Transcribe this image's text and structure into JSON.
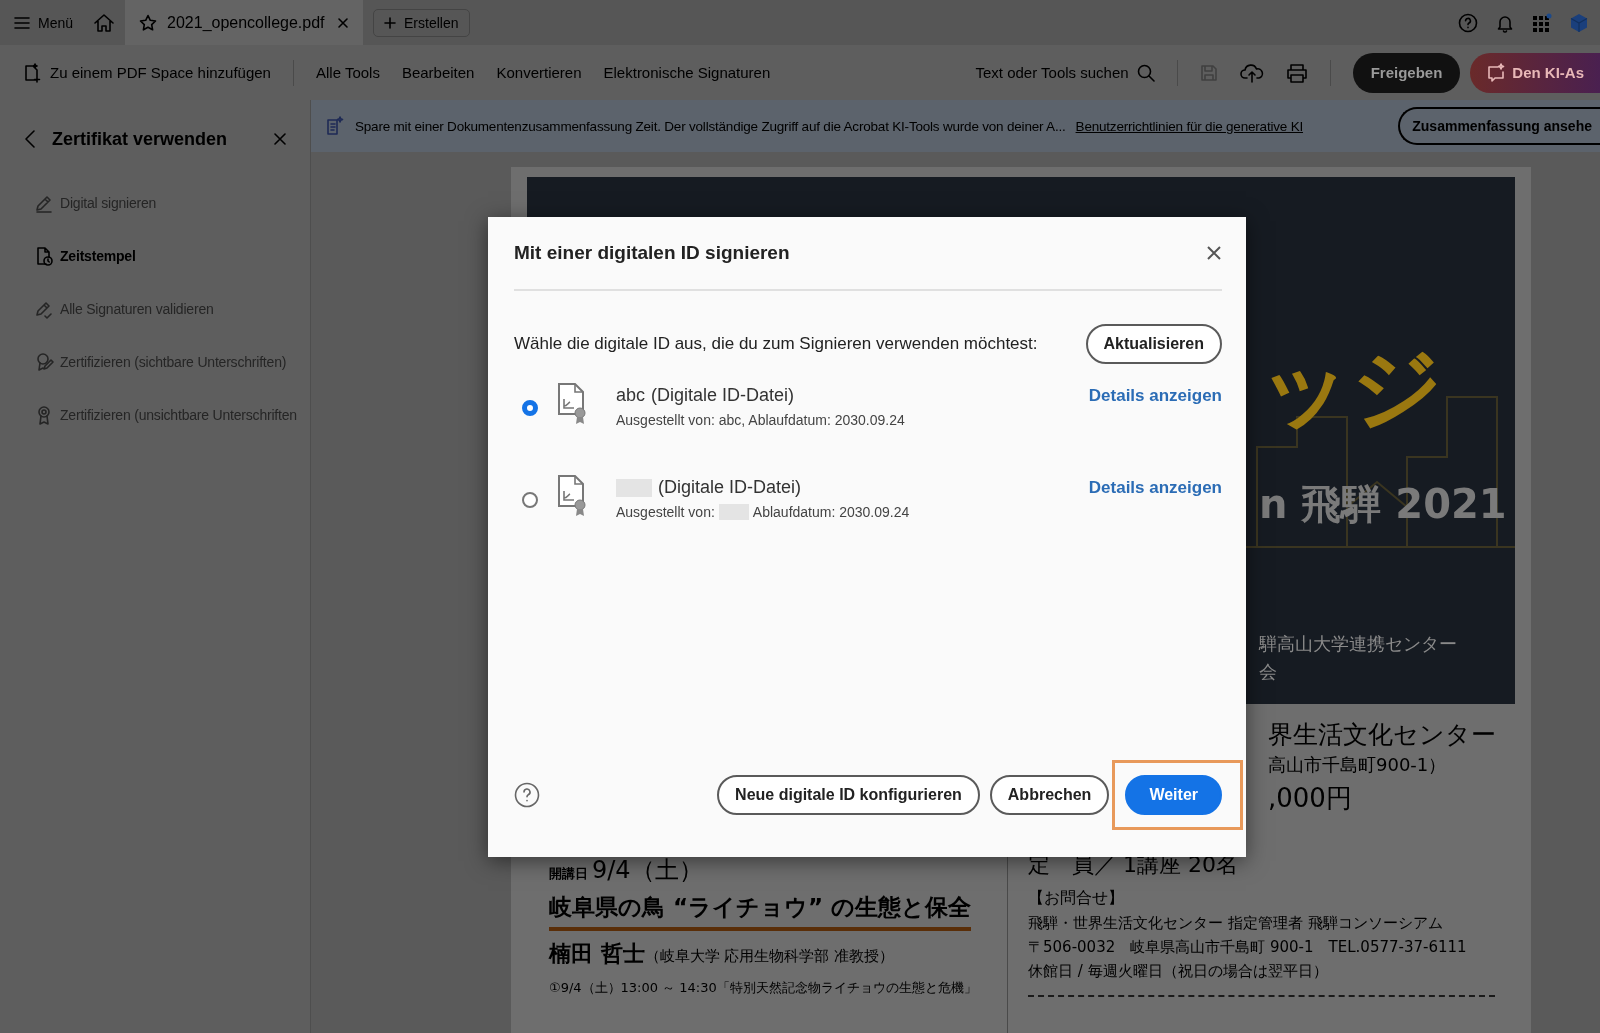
{
  "top_bar": {
    "menu_label": "Menü",
    "tabs": [
      {
        "label": "2021_opencollege.pdf",
        "selected": true
      }
    ],
    "create_label": "Erstellen"
  },
  "toolbar": {
    "space_label": "Zu einem PDF Space hinzufügen",
    "menu": [
      "Alle Tools",
      "Bearbeiten",
      "Konvertieren",
      "Elektronische Signaturen"
    ],
    "search_label": "Text oder Tools suchen",
    "share_label": "Freigeben",
    "ai_label": "Den KI-As"
  },
  "side_panel": {
    "title": "Zertifikat verwenden",
    "items": [
      {
        "label": "Digital signieren",
        "disabled": true
      },
      {
        "label": "Zeitstempel",
        "disabled": false
      },
      {
        "label": "Alle Signaturen validieren",
        "disabled": true
      },
      {
        "label": "Zertifizieren (sichtbare Unterschriften)",
        "disabled": true
      },
      {
        "label": "Zertifizieren (unsichtbare Unterschriften",
        "disabled": true
      }
    ]
  },
  "banner": {
    "text": "Spare mit einer Dokumentenzusammenfassung Zeit. Der vollständige Zugriff auf die Acrobat KI-Tools wurde von deiner A...",
    "link": "Benutzerrichtlinien für die generative KI",
    "button": "Zusammenfassung ansehe"
  },
  "document": {
    "poster_texts": [
      "ッジ",
      "n 飛騨 2021",
      "騨高山大学連携センター",
      "会"
    ],
    "right_lines": [
      "界生活文化センター",
      "高山市千島町900-1）",
      ",000円",
      "定　員／ 1講座 20名",
      "【お問合せ】",
      "飛騨・世界生活文化センター 指定管理者 飛騨コンソーシアム",
      "〒506-0032　岐阜県高山市千島町 900-1　TEL.0577-37-6111",
      "休館日 / 毎週火曜日（祝日の場合は翌平日）"
    ],
    "date_label": "開講日",
    "date": "9/4（土）",
    "title": "岐阜県の鳥 “ライチョウ” の生態と保全",
    "lecturer": "楠田 哲士",
    "affiliation": "（岐阜大学 応用生物科学部 准教授）",
    "session": "①9/4（土）13:00 ～ 14:30「特別天然記念物ライチョウの生態と危機」"
  },
  "dialog": {
    "title": "Mit einer digitalen ID signieren",
    "prompt": "Wähle die digitale ID aus, die du zum Signieren verwenden möchtest:",
    "refresh_label": "Aktualisieren",
    "ids": [
      {
        "name": "abc",
        "type": "(Digitale ID-Datei)",
        "line_parts": [
          "Ausgestellt von: abc, Ablaufdatum: 2030.09.24"
        ],
        "details_label": "Details anzeigen",
        "selected": true
      },
      {
        "type": "(Digitale ID-Datei)",
        "line_parts": [
          "Ausgestellt von:",
          "Ablaufdatum: 2030.09.24"
        ],
        "details_label": "Details anzeigen",
        "selected": false
      }
    ],
    "buttons": [
      {
        "label": "Neue digitale ID konfigurieren",
        "kind": "secondary",
        "highlighted": false
      },
      {
        "label": "Abbrechen",
        "kind": "secondary",
        "highlighted": false
      },
      {
        "label": "Weiter",
        "kind": "primary",
        "highlighted": true
      }
    ]
  }
}
